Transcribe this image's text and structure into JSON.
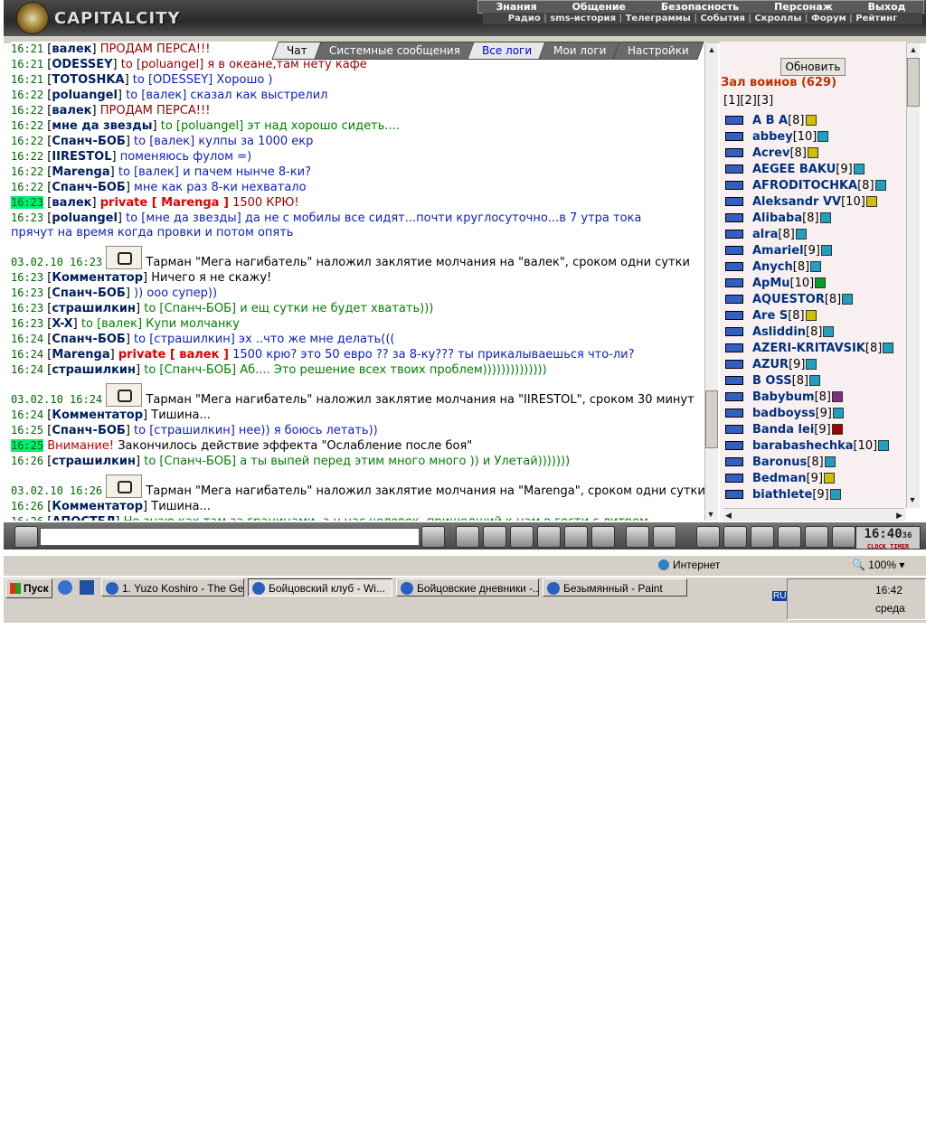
{
  "header": {
    "logo_text": "CAPITALCITY",
    "menu_top": [
      "Знания",
      "Общение",
      "Безопасность",
      "Персонаж",
      "Выход"
    ],
    "menu_sub": [
      "Радио",
      "sms-история",
      "Телеграммы",
      "События",
      "Скроллы",
      "Форум",
      "Рейтинг"
    ]
  },
  "tabs": [
    "Чат",
    "Системные сообщения",
    "Все логи",
    "Мои логи",
    "Настройки"
  ],
  "chat": [
    {
      "ts": "16:21",
      "nick": "валек",
      "to": "",
      "msg": "ПРОДАМ ПЕРСА!!!",
      "cls": "darkred"
    },
    {
      "ts": "16:21",
      "nick": "ODESSEY",
      "to": "poluangel",
      "msg": "я в океане,там нету кафе",
      "cls": "darkred"
    },
    {
      "ts": "16:21",
      "nick": "TOTOSHKA",
      "to": "ODESSEY",
      "msg": "Хорошо )",
      "cls": "blue"
    },
    {
      "ts": "16:22",
      "nick": "poluangel",
      "to": "валек",
      "msg": "сказал как выстрелил",
      "cls": "blue"
    },
    {
      "ts": "16:22",
      "nick": "валек",
      "to": "",
      "msg": "ПРОДАМ ПЕРСА!!!",
      "cls": "darkred"
    },
    {
      "ts": "16:22",
      "nick": "мне да звезды",
      "to": "poluangel",
      "msg": "эт над хорошо сидеть....",
      "cls": "green"
    },
    {
      "ts": "16:22",
      "nick": "Спанч-БОБ",
      "to": "валек",
      "msg": "кулпы за 1000 екр",
      "cls": "blue"
    },
    {
      "ts": "16:22",
      "nick": "IIRESTOL",
      "to": "",
      "msg": "поменяюсь фулом =)",
      "cls": "blue"
    },
    {
      "ts": "16:22",
      "nick": "Marenga",
      "to": "валек",
      "msg": "и пачем нынче 8-ки?",
      "cls": "blue"
    },
    {
      "ts": "16:22",
      "nick": "Спанч-БОБ",
      "to": "",
      "msg": "мне как раз 8-ки нехватало",
      "cls": "blue"
    },
    {
      "ts": "16:23",
      "nick": "валек",
      "to": "",
      "private": "private [ Marenga ]",
      "msg": "1500 КРЮ!",
      "cls": "red",
      "hl": true
    },
    {
      "ts": "16:23",
      "nick": "poluangel",
      "to": "мне да звезды",
      "msg": "да не с мобилы все сидят...почти круглосуточно...в 7 утра тока",
      "cls": "blue",
      "wrap": "прячут на время когда провки и потом опять"
    },
    {
      "sys": true,
      "date": "03.02.10 16:23",
      "text": "Тарман \"Мега нагибатель\" наложил заклятие молчания на \"валек\", сроком одни сутки"
    },
    {
      "ts": "16:23",
      "nick": "Комментатор",
      "to": "",
      "msg": "Ничего я не скажу!",
      "cls": "plain"
    },
    {
      "ts": "16:23",
      "nick": "Спанч-БОБ",
      "to": "",
      "msg": ")) ооо супер))",
      "cls": "blue"
    },
    {
      "ts": "16:23",
      "nick": "страшилкин",
      "to": "Спанч-БОБ",
      "msg": "и ещ сутки не будет хватать)))",
      "cls": "green"
    },
    {
      "ts": "16:23",
      "nick": "X-X",
      "to": "валек",
      "msg": "Купи молчанку",
      "cls": "teal"
    },
    {
      "ts": "16:24",
      "nick": "Спанч-БОБ",
      "to": "страшилкин",
      "msg": "эх ..что же мне делать(((",
      "cls": "blue"
    },
    {
      "ts": "16:24",
      "nick": "Marenga",
      "to": "",
      "private": "private [ валек ]",
      "msg": "1500 крю? это 50 евро ?? за 8-ку??? ты прикалываешься что-ли?",
      "cls": "blue"
    },
    {
      "ts": "16:24",
      "nick": "страшилкин",
      "to": "Спанч-БОБ",
      "msg": "Аб.... Это решение всех твоих проблем))))))))))))))",
      "cls": "green"
    },
    {
      "sys": true,
      "date": "03.02.10 16:24",
      "text": "Тарман \"Мега нагибатель\" наложил заклятие молчания на \"IIRESTOL\", сроком 30 минут"
    },
    {
      "ts": "16:24",
      "nick": "Комментатор",
      "to": "",
      "msg": "Тишина...",
      "cls": "plain"
    },
    {
      "ts": "16:25",
      "nick": "Спанч-БОБ",
      "to": "страшилкин",
      "msg": "нее)) я боюсь летать))",
      "cls": "blue"
    },
    {
      "ts": "16:25",
      "warn": true,
      "warn_label": "Внимание!",
      "msg": "Закончилось действие эффекта \"Ослабление после боя\"",
      "hl": true
    },
    {
      "ts": "16:26",
      "nick": "страшилкин",
      "to": "Спанч-БОБ",
      "msg": "а ты выпей перед этим много много )) и Улетай)))))))",
      "cls": "green"
    },
    {
      "sys": true,
      "date": "03.02.10 16:26",
      "text": "Тарман \"Мега нагибатель\" наложил заклятие молчания на \"Marenga\", сроком одни сутки"
    },
    {
      "ts": "16:26",
      "nick": "Комментатор",
      "to": "",
      "msg": "Тишина...",
      "cls": "plain"
    },
    {
      "ts": "16:26",
      "nick": "АПОСТЕЛ",
      "to": "",
      "msg": "Не знаю как там за границами, а у нас человек, пришедший к нам в гости с литром",
      "cls": "green"
    }
  ],
  "right": {
    "refresh_label": "Обновить",
    "hall_title": "Зал воинов (629)",
    "pages": "[1][2][3]",
    "users": [
      {
        "name": "A B A",
        "lvl": "[8]",
        "info": "y"
      },
      {
        "name": "abbey",
        "lvl": "[10]",
        "info": "b"
      },
      {
        "name": "Acrev",
        "lvl": "[8]",
        "info": "y"
      },
      {
        "name": "AEGEE BAKU",
        "lvl": "[9]",
        "info": "b"
      },
      {
        "name": "AFRODITOCHKA",
        "lvl": "[8]",
        "info": "b"
      },
      {
        "name": "Aleksandr VV",
        "lvl": "[10]",
        "info": "y"
      },
      {
        "name": "Alibaba",
        "lvl": "[8]",
        "info": "b"
      },
      {
        "name": "alra",
        "lvl": "[8]",
        "info": "b"
      },
      {
        "name": "Amariel",
        "lvl": "[9]",
        "info": "b"
      },
      {
        "name": "Anych",
        "lvl": "[8]",
        "info": "b"
      },
      {
        "name": "ApMu",
        "lvl": "[10]",
        "info": "g"
      },
      {
        "name": "AQUESTOR",
        "lvl": "[8]",
        "info": "b"
      },
      {
        "name": "Are S",
        "lvl": "[8]",
        "info": "y"
      },
      {
        "name": "Asliddin",
        "lvl": "[8]",
        "info": "b"
      },
      {
        "name": "AZERI-KRITAVSIK",
        "lvl": "[8]",
        "info": "b"
      },
      {
        "name": "AZUR",
        "lvl": "[9]",
        "info": "b"
      },
      {
        "name": "B OSS",
        "lvl": "[8]",
        "info": "b"
      },
      {
        "name": "Babybum",
        "lvl": "[8]",
        "info": "p"
      },
      {
        "name": "badboyss",
        "lvl": "[9]",
        "info": "b"
      },
      {
        "name": "Banda lei",
        "lvl": "[9]",
        "info": "r"
      },
      {
        "name": "barabashechka",
        "lvl": "[10]",
        "info": "b"
      },
      {
        "name": "Baronus",
        "lvl": "[8]",
        "info": "b"
      },
      {
        "name": "Bedman",
        "lvl": "[9]",
        "info": "y"
      },
      {
        "name": "biathlete",
        "lvl": "[9]",
        "info": "b"
      }
    ]
  },
  "clock": {
    "time": "16:40",
    "sec": "36",
    "clock_label": "CLOCK",
    "timer_label": "TIMER"
  },
  "statusbar": {
    "zone": "Интернет",
    "zoom": "100%"
  },
  "taskbar": {
    "start": "Пуск",
    "tasks": [
      "1. Yuzo Koshiro - The Ge...",
      "Бойцовский клуб - Wi...",
      "Бойцовские дневники -...",
      "Безымянный - Paint"
    ],
    "lang": "RU",
    "time": "16:42",
    "day": "среда"
  }
}
